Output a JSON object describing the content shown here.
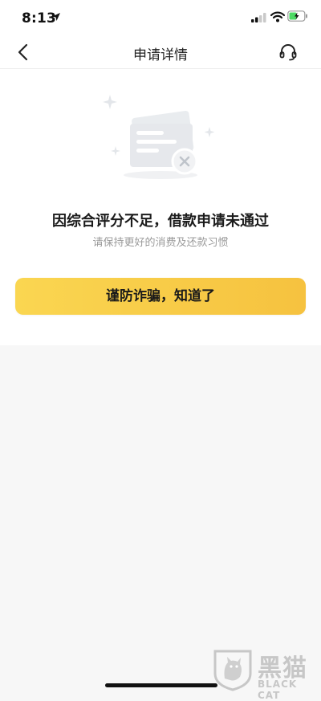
{
  "status_bar": {
    "time": "8:13"
  },
  "nav": {
    "title": "申请详情"
  },
  "result": {
    "message": "因综合评分不足，借款申请未通过",
    "subtitle": "请保持更好的消费及还款习惯"
  },
  "action": {
    "button_label": "谨防诈骗，知道了"
  },
  "watermark": {
    "cn": "黑猫",
    "en": "BLACK CAT"
  },
  "colors": {
    "accent_start": "#fad651",
    "accent_end": "#f6c23f",
    "page_bg": "#f7f7f7"
  },
  "icons": [
    "location-arrow-icon",
    "signal-icon",
    "wifi-icon",
    "battery-icon",
    "back-chevron-icon",
    "headset-icon",
    "rejected-card-illustration"
  ]
}
